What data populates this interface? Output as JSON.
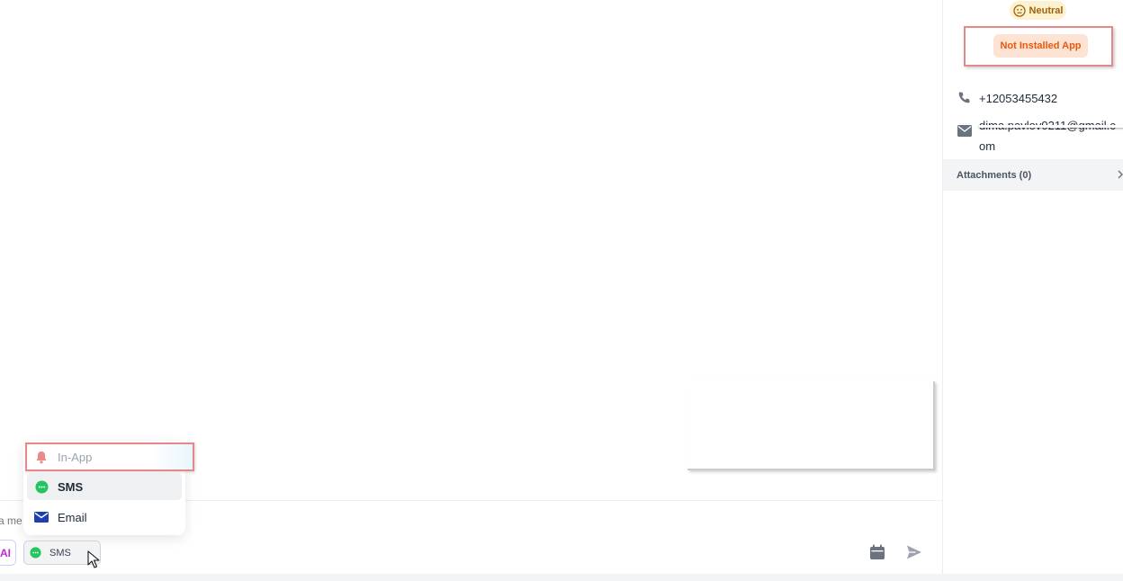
{
  "channel_menu": {
    "items": [
      {
        "label": "In-App",
        "icon": "bell-icon",
        "color": "#e8898a"
      },
      {
        "label": "SMS",
        "icon": "chat-bubble-icon",
        "color": "#22c55e"
      },
      {
        "label": "Email",
        "icon": "envelope-icon",
        "color": "#1e40af"
      }
    ]
  },
  "composer": {
    "placeholder": "a me",
    "ai_label": "AI",
    "channel": {
      "label": "SMS",
      "icon": "chat-bubble-icon"
    },
    "actions": [
      {
        "name": "schedule",
        "icon": "calendar-icon"
      },
      {
        "name": "send",
        "icon": "send-icon"
      }
    ]
  },
  "contact": {
    "sentiment": {
      "label": "Neutral",
      "icon": "neutral-face-icon"
    },
    "status": "Not Installed App",
    "phone": "+12053455432",
    "email": "dima.pavlov0211@gmail.com",
    "attachments_label": "Attachments (0)"
  },
  "colors": {
    "accent_green": "#22c55e",
    "sentiment_bg": "#fdf2d0",
    "status_bg": "#fde3d3",
    "status_text": "#ea580c",
    "highlight_frame": "#e6888a"
  }
}
